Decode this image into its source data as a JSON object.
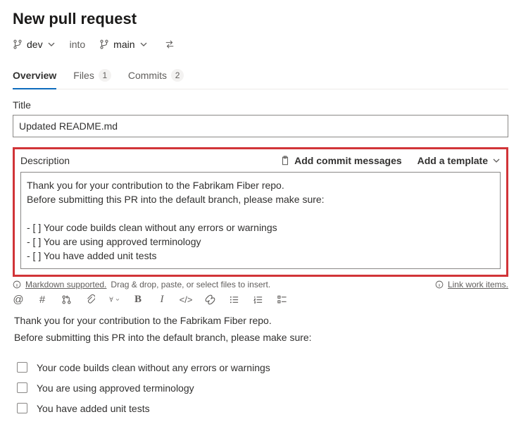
{
  "header": {
    "page_title": "New pull request"
  },
  "branches": {
    "source": "dev",
    "into_word": "into",
    "target": "main"
  },
  "tabs": {
    "overview": {
      "label": "Overview"
    },
    "files": {
      "label": "Files",
      "count": "1"
    },
    "commits": {
      "label": "Commits",
      "count": "2"
    }
  },
  "title_field": {
    "label": "Title",
    "value": "Updated README.md"
  },
  "description": {
    "label": "Description",
    "add_commit_messages": "Add commit messages",
    "add_template": "Add a template",
    "raw_text": "Thank you for your contribution to the Fabrikam Fiber repo.\nBefore submitting this PR into the default branch, please make sure:\n\n- [ ] Your code builds clean without any errors or warnings\n- [ ] You are using approved terminology\n- [ ] You have added unit tests"
  },
  "hints": {
    "markdown_supported": "Markdown supported.",
    "drag_drop": "Drag & drop, paste, or select files to insert.",
    "link_work_items": "Link work items."
  },
  "preview": {
    "intro_line1": "Thank you for your contribution to the Fabrikam Fiber repo.",
    "intro_line2": "Before submitting this PR into the default branch, please make sure:",
    "checks": [
      "Your code builds clean without any errors or warnings",
      "You are using approved terminology",
      "You have added unit tests"
    ]
  }
}
